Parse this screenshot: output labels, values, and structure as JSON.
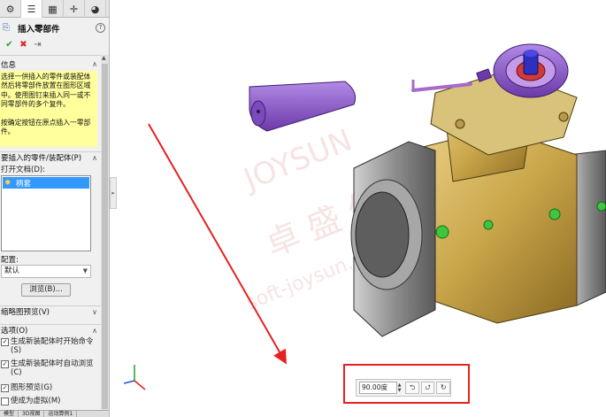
{
  "property_manager": {
    "tabs": [
      {
        "icon": "gear-icon",
        "glyph": "⚙"
      },
      {
        "icon": "property-manager-icon",
        "glyph": "☰"
      },
      {
        "icon": "configuration-icon",
        "glyph": "▦"
      },
      {
        "icon": "dimxpert-icon",
        "glyph": "✛"
      },
      {
        "icon": "display-manager-icon",
        "glyph": "◕"
      }
    ],
    "title": "插入零部件",
    "help_glyph": "?",
    "actions": {
      "ok": "✔",
      "cancel": "✖",
      "pin": "⇥"
    },
    "info_section": {
      "label": "信息",
      "chevron": "∧",
      "message_1": "选择一供插入的零件或装配体然后将零部件放置在图形区域中。使用图钉来插入同一或不同零部件的多个复件。",
      "message_2": "按确定按钮在原点插入一零部件。"
    },
    "part_section": {
      "label": "要插入的零件/装配体(P)",
      "chevron": "∧",
      "open_docs_label": "打开文档(D):",
      "documents": [
        "柄套"
      ],
      "config_label": "配置:",
      "config_value": "默认",
      "browse_label": "浏览(B)..."
    },
    "thumbnail_section": {
      "label": "缩略图预览(V)",
      "chevron": "∨"
    },
    "options_section": {
      "label": "选项(O)",
      "chevron": "∧",
      "options": [
        {
          "label": "生成新装配体时开始命令(S)",
          "checked": true
        },
        {
          "label": "生成新装配体时自动浏览(C)",
          "checked": true
        },
        {
          "label": "图形预览(G)",
          "checked": true
        },
        {
          "label": "使成为虚拟(M)",
          "checked": false
        }
      ]
    },
    "bottom_tabs": [
      "模型",
      "3D视图",
      "运动算例1"
    ]
  },
  "viewport": {
    "watermark_text": "JOYSUN",
    "watermark_cn": "卓 盛 信",
    "watermark_url": "soft-joysun.com",
    "rotate_toolbar": {
      "angle_value": "90.00度",
      "buttons": [
        {
          "icon": "rotate-x-icon",
          "glyph": "⮌"
        },
        {
          "icon": "rotate-y-icon",
          "glyph": "⮍"
        },
        {
          "icon": "rotate-z-icon",
          "glyph": "↻"
        }
      ]
    },
    "colors": {
      "highlight": "#e52121",
      "body_gold": "#c9a64a",
      "flange_gray": "#8e8e8e",
      "handle_purple": "#8a55c9",
      "stem_blue": "#2f2fbf",
      "bolt_green": "#3fc63f"
    }
  }
}
